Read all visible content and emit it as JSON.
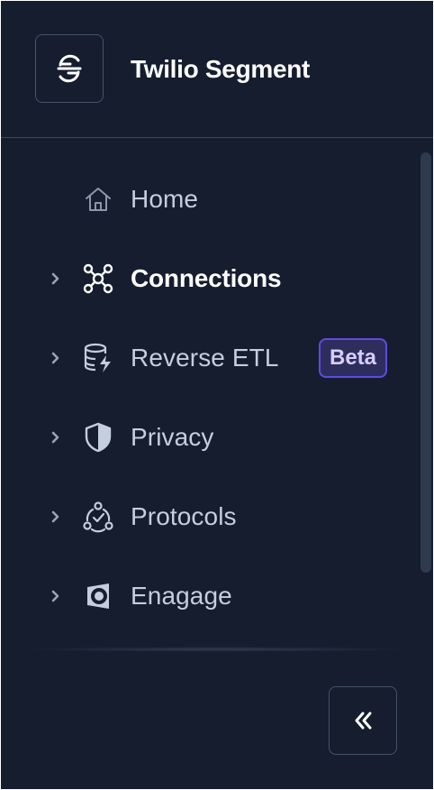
{
  "app": {
    "title": "Twilio Segment",
    "logo_icon": "segment-logo-icon"
  },
  "nav": {
    "items": [
      {
        "label": "Home",
        "icon": "home-icon",
        "expandable": false,
        "active": false
      },
      {
        "label": "Connections",
        "icon": "connections-icon",
        "expandable": true,
        "active": true
      },
      {
        "label": "Reverse ETL",
        "icon": "database-bolt-icon",
        "expandable": true,
        "active": false,
        "badge": "Beta"
      },
      {
        "label": "Privacy",
        "icon": "shield-icon",
        "expandable": true,
        "active": false
      },
      {
        "label": "Protocols",
        "icon": "protocols-icon",
        "expandable": true,
        "active": false
      },
      {
        "label": "Enagage",
        "icon": "engage-icon",
        "expandable": true,
        "active": false
      }
    ]
  },
  "footer": {
    "collapse_icon": "chevrons-left-icon"
  },
  "colors": {
    "background": "#151d2e",
    "text": "#c5cedd",
    "active_text": "#ffffff",
    "badge_border": "#5f4be0",
    "badge_bg": "#2d2e5e",
    "badge_text": "#d7cdfa"
  }
}
